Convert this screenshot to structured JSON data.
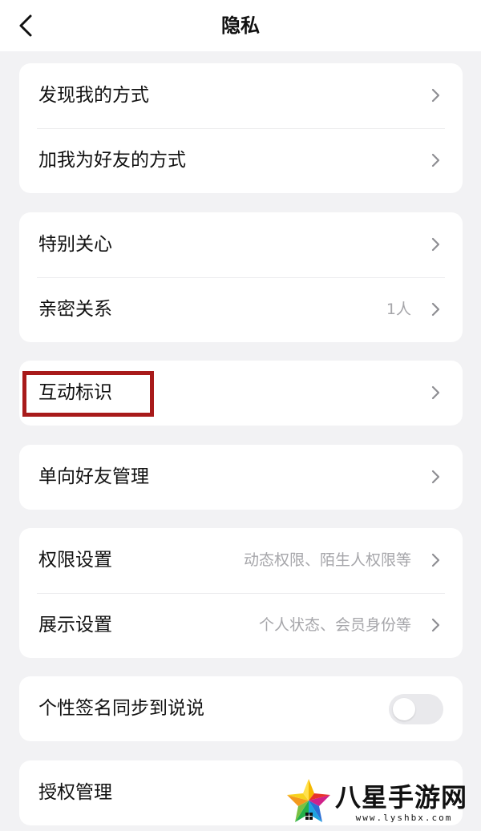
{
  "header": {
    "title": "隐私",
    "back_icon": "chevron-left-icon"
  },
  "groups": [
    {
      "rows": [
        {
          "label": "发现我的方式",
          "value": ""
        },
        {
          "label": "加我为好友的方式",
          "value": ""
        }
      ]
    },
    {
      "rows": [
        {
          "label": "特别关心",
          "value": ""
        },
        {
          "label": "亲密关系",
          "value": "1人"
        }
      ]
    },
    {
      "rows": [
        {
          "label": "互动标识",
          "value": ""
        }
      ]
    },
    {
      "rows": [
        {
          "label": "单向好友管理",
          "value": ""
        }
      ]
    },
    {
      "rows": [
        {
          "label": "权限设置",
          "value": "动态权限、陌生人权限等"
        },
        {
          "label": "展示设置",
          "value": "个人状态、会员身份等"
        }
      ]
    },
    {
      "rows": [
        {
          "label": "个性签名同步到说说",
          "toggle_on": false
        }
      ]
    },
    {
      "rows": [
        {
          "label": "授权管理",
          "value": ""
        }
      ]
    }
  ],
  "annotation": {
    "highlight_color": "#a81a1a"
  },
  "watermark": {
    "title": "八星手游网",
    "url": "www.lyshbx.com"
  },
  "colors": {
    "background": "#f2f2f4",
    "card": "#ffffff",
    "secondary_text": "#a6a6aa",
    "chevron": "#8e8e93"
  }
}
